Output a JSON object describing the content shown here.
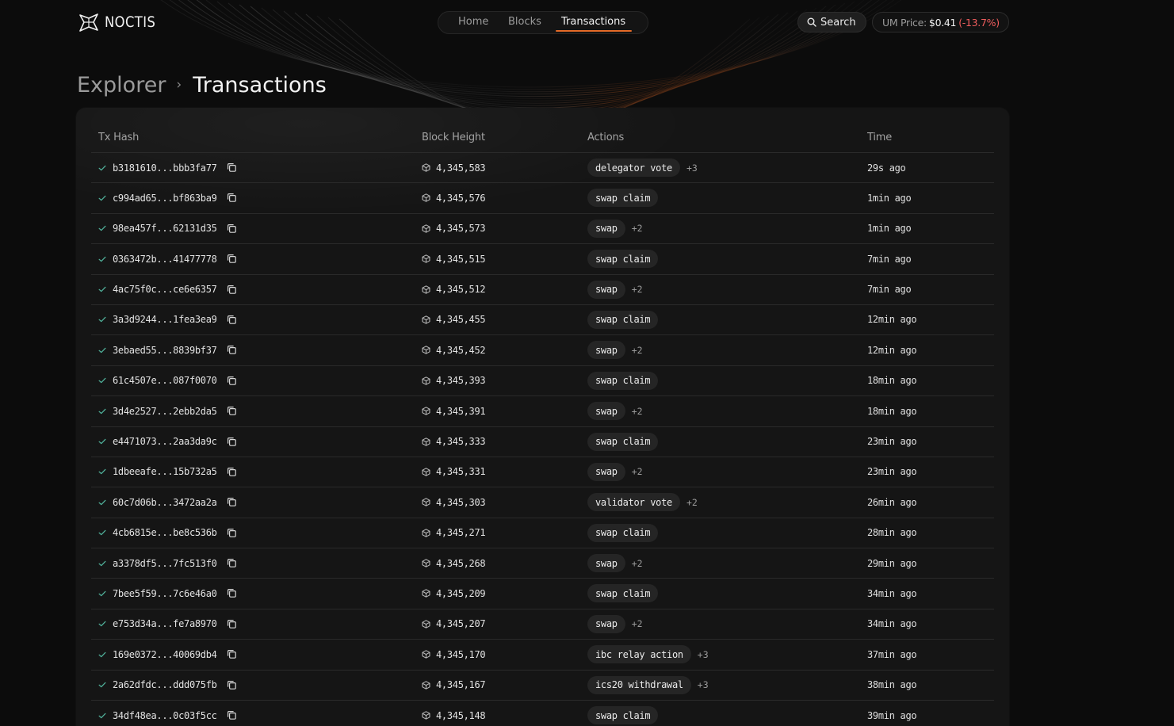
{
  "header": {
    "brand": "NOCTIS",
    "nav": [
      {
        "label": "Home"
      },
      {
        "label": "Blocks"
      },
      {
        "label": "Transactions",
        "active": true
      }
    ],
    "search_label": "Search",
    "price": {
      "label": "UM Price:",
      "value": "$0.41",
      "change": "(-13.7%)"
    }
  },
  "breadcrumb": {
    "root": "Explorer",
    "separator": "›",
    "current": "Transactions"
  },
  "table": {
    "columns": [
      "Tx Hash",
      "Block Height",
      "Actions",
      "Time"
    ],
    "rows": [
      {
        "hash": "b3181610...bbb3fa77",
        "block": "4,345,583",
        "action": "delegator vote",
        "more": "+3",
        "time": "29s ago"
      },
      {
        "hash": "c994ad65...bf863ba9",
        "block": "4,345,576",
        "action": "swap claim",
        "more": "",
        "time": "1min ago"
      },
      {
        "hash": "98ea457f...62131d35",
        "block": "4,345,573",
        "action": "swap",
        "more": "+2",
        "time": "1min ago"
      },
      {
        "hash": "0363472b...41477778",
        "block": "4,345,515",
        "action": "swap claim",
        "more": "",
        "time": "7min ago"
      },
      {
        "hash": "4ac75f0c...ce6e6357",
        "block": "4,345,512",
        "action": "swap",
        "more": "+2",
        "time": "7min ago"
      },
      {
        "hash": "3a3d9244...1fea3ea9",
        "block": "4,345,455",
        "action": "swap claim",
        "more": "",
        "time": "12min ago"
      },
      {
        "hash": "3ebaed55...8839bf37",
        "block": "4,345,452",
        "action": "swap",
        "more": "+2",
        "time": "12min ago"
      },
      {
        "hash": "61c4507e...087f0070",
        "block": "4,345,393",
        "action": "swap claim",
        "more": "",
        "time": "18min ago"
      },
      {
        "hash": "3d4e2527...2ebb2da5",
        "block": "4,345,391",
        "action": "swap",
        "more": "+2",
        "time": "18min ago"
      },
      {
        "hash": "e4471073...2aa3da9c",
        "block": "4,345,333",
        "action": "swap claim",
        "more": "",
        "time": "23min ago"
      },
      {
        "hash": "1dbeeafe...15b732a5",
        "block": "4,345,331",
        "action": "swap",
        "more": "+2",
        "time": "23min ago"
      },
      {
        "hash": "60c7d06b...3472aa2a",
        "block": "4,345,303",
        "action": "validator vote",
        "more": "+2",
        "time": "26min ago"
      },
      {
        "hash": "4cb6815e...be8c536b",
        "block": "4,345,271",
        "action": "swap claim",
        "more": "",
        "time": "28min ago"
      },
      {
        "hash": "a3378df5...7fc513f0",
        "block": "4,345,268",
        "action": "swap",
        "more": "+2",
        "time": "29min ago"
      },
      {
        "hash": "7bee5f59...7c6e46a0",
        "block": "4,345,209",
        "action": "swap claim",
        "more": "",
        "time": "34min ago"
      },
      {
        "hash": "e753d34a...fe7a8970",
        "block": "4,345,207",
        "action": "swap",
        "more": "+2",
        "time": "34min ago"
      },
      {
        "hash": "169e0372...40069db4",
        "block": "4,345,170",
        "action": "ibc relay action",
        "more": "+3",
        "time": "37min ago"
      },
      {
        "hash": "2a62dfdc...ddd075fb",
        "block": "4,345,167",
        "action": "ics20 withdrawal",
        "more": "+3",
        "time": "38min ago"
      },
      {
        "hash": "34df48ea...0c03f5cc",
        "block": "4,345,148",
        "action": "swap claim",
        "more": "",
        "time": "39min ago"
      }
    ]
  },
  "icons": {
    "logo": "noctis-logo-icon",
    "search": "search-icon",
    "status": "check-icon",
    "copy": "copy-icon",
    "block": "cube-icon"
  },
  "colors": {
    "background": "#0c0c0c",
    "card": "#151515",
    "accent": "#e46a27",
    "negative": "#ef5d5d",
    "success": "#4fae98"
  }
}
